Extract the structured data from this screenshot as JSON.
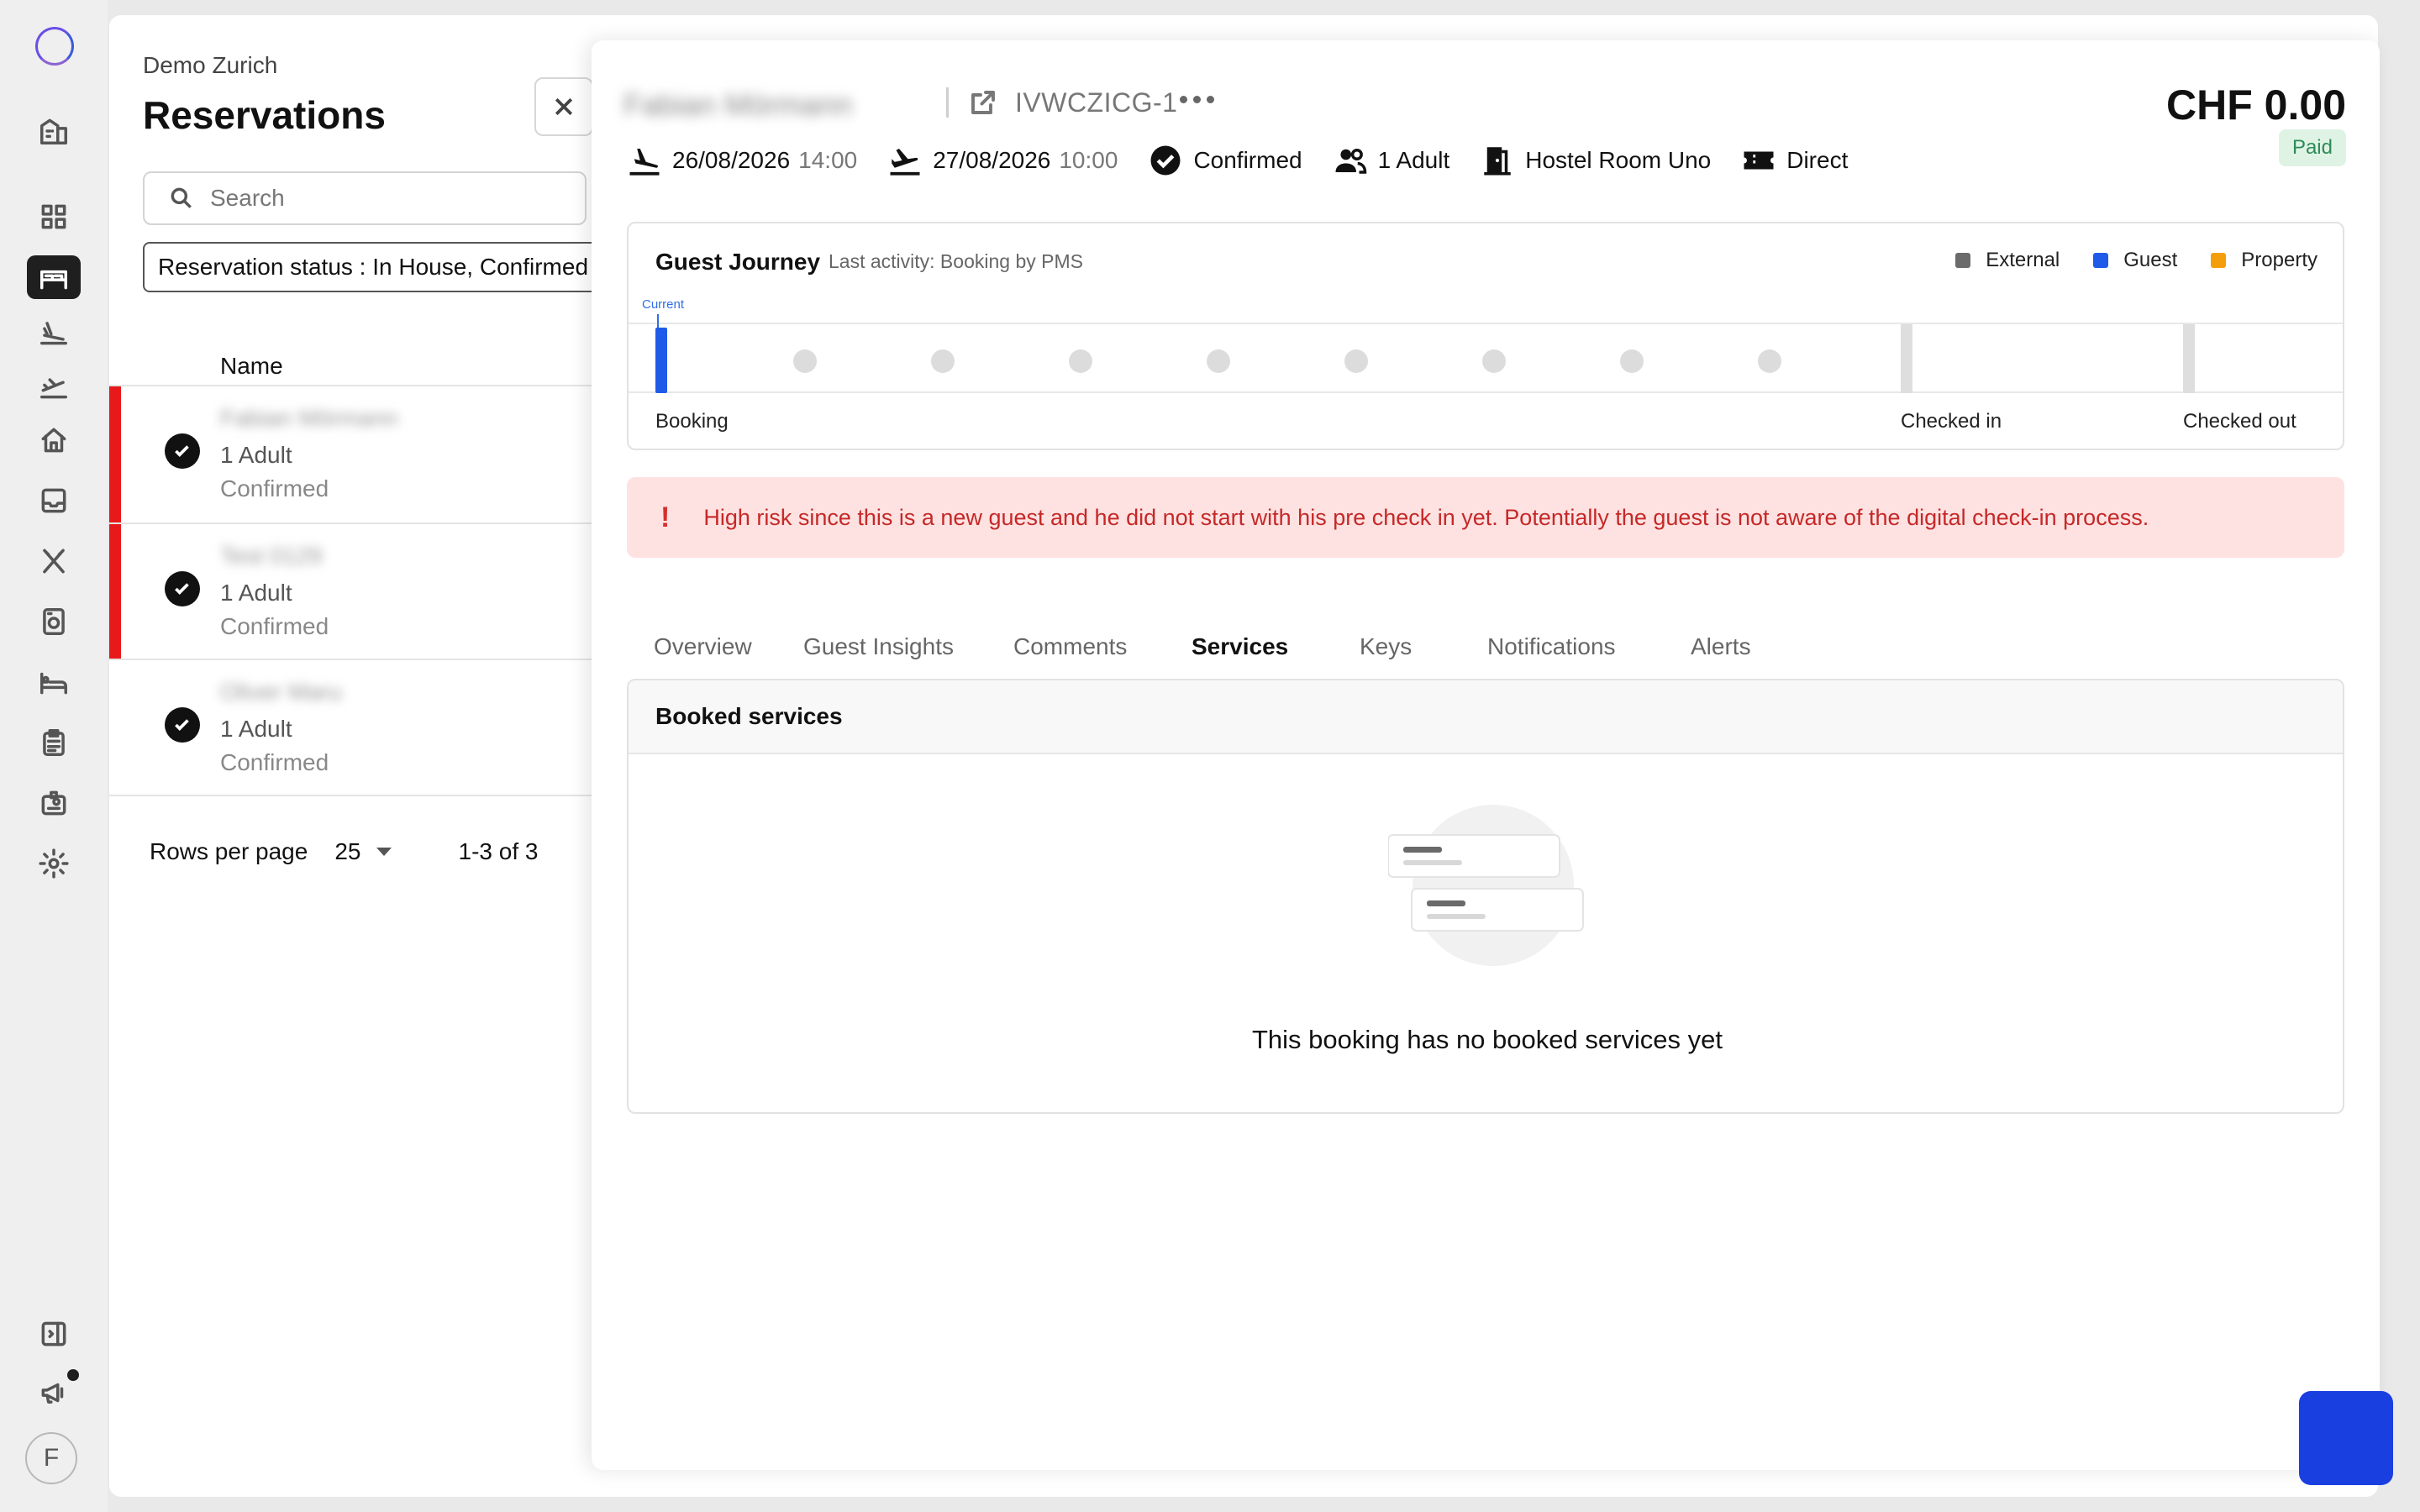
{
  "rail": {
    "avatar_initial": "F",
    "icons": [
      "logo-icon",
      "building-icon",
      "dashboard-icon",
      "bed-icon",
      "arrival-icon",
      "departure-icon",
      "home-icon",
      "inbox-icon",
      "restaurant-icon",
      "checkin-device-icon",
      "room-icon",
      "clipboard-icon",
      "id-card-icon",
      "settings-icon",
      "collapse-sidebar-icon",
      "announcement-icon"
    ]
  },
  "list": {
    "hotel_name": "Demo Zurich",
    "title": "Reservations",
    "search_placeholder": "Search",
    "filter_label": "Reservation status : In House, Confirmed",
    "column_name": "Name",
    "rows": [
      {
        "name": "Fabian Mörmann",
        "adults": "1 Adult",
        "status": "Confirmed",
        "flagged": true
      },
      {
        "name": "Test 0129",
        "adults": "1 Adult",
        "status": "Confirmed",
        "flagged": true
      },
      {
        "name": "Oliver Maru",
        "adults": "1 Adult",
        "status": "Confirmed",
        "flagged": false
      }
    ],
    "rows_per_page_label": "Rows per page",
    "rows_per_page_value": "25",
    "range": "1-3 of 3"
  },
  "detail": {
    "guest_name": "Fabian Mörmann",
    "booking_ref": "IVWCZICG-1",
    "price": "CHF 0.00",
    "payment_status": "Paid",
    "arrival_date": "26/08/2026",
    "arrival_time": "14:00",
    "departure_date": "27/08/2026",
    "departure_time": "10:00",
    "status": "Confirmed",
    "guests": "1 Adult",
    "room": "Hostel Room Uno",
    "channel": "Direct",
    "journey": {
      "title": "Guest Journey",
      "last_activity": "Last activity: Booking by PMS",
      "current_label": "Current",
      "legend": [
        {
          "label": "External",
          "color": "#6b6b6b"
        },
        {
          "label": "Guest",
          "color": "#1f5be8"
        },
        {
          "label": "Property",
          "color": "#f59e0b"
        }
      ],
      "phases": [
        "Booking",
        "Checked in",
        "Checked out"
      ]
    },
    "alert_message": "High risk since this is a new guest and he did not start with his pre check in yet. Potentially the guest is not aware of the digital check-in process.",
    "tabs": [
      "Overview",
      "Guest Insights",
      "Comments",
      "Services",
      "Keys",
      "Notifications",
      "Alerts"
    ],
    "active_tab": "Services",
    "services": {
      "header": "Booked services",
      "empty_text": "This booking has no booked services yet"
    }
  }
}
